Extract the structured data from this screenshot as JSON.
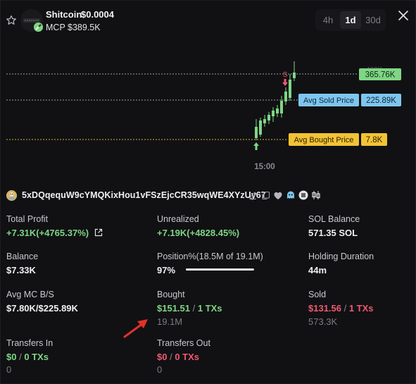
{
  "token": {
    "name": "Shitcoin",
    "price": "$0.0004",
    "mcp": "MCP $389.5K"
  },
  "timeframes": [
    {
      "label": "4h",
      "active": false
    },
    {
      "label": "1d",
      "active": true
    },
    {
      "label": "30d",
      "active": false
    }
  ],
  "chart": {
    "ticker_label": "400K",
    "price_tags": [
      {
        "label": "",
        "value": "365.76K",
        "color": "#7fd685"
      },
      {
        "label": "Avg Sold Price",
        "value": "225.89K",
        "color": "#7ec6ef"
      },
      {
        "label": "Avg Bought Price",
        "value": "7.8K",
        "color": "#f2c335"
      }
    ],
    "time_label": "15:00",
    "markers": {
      "sell": "S"
    }
  },
  "wallet": {
    "address": "5xDQqequW9cYMQKixHou1vFSzEjcCR35wqWE4XYzUy67"
  },
  "stats": {
    "total_profit": {
      "label": "Total Profit",
      "value": "+7.31K(+4765.37%)"
    },
    "unrealized": {
      "label": "Unrealized",
      "value": "+7.19K(+4828.45%)"
    },
    "sol_balance": {
      "label": "SOL Balance",
      "value": "571.35 SOL"
    },
    "balance": {
      "label": "Balance",
      "value": "$7.33K"
    },
    "position": {
      "label": "Position%(18.5M of 19.1M)",
      "value": "97%",
      "fraction": 0.97
    },
    "holding_duration": {
      "label": "Holding Duration",
      "value": "44m"
    },
    "avg_mc": {
      "label": "Avg MC B/S",
      "value": "$7.80K/$225.89K"
    },
    "bought": {
      "label": "Bought",
      "amount": "$151.51",
      "sep": " / ",
      "txs": "1 TXs",
      "sub": "19.1M"
    },
    "sold": {
      "label": "Sold",
      "amount": "$131.56",
      "sep": " / ",
      "txs": "1 TXs",
      "sub": "573.3K"
    },
    "transfers_in": {
      "label": "Transfers In",
      "amount": "$0",
      "sep": " / ",
      "txs": "0 TXs",
      "sub": "0"
    },
    "transfers_out": {
      "label": "Transfers Out",
      "amount": "$0",
      "sep": " / ",
      "txs": "0 TXs",
      "sub": "0"
    }
  }
}
